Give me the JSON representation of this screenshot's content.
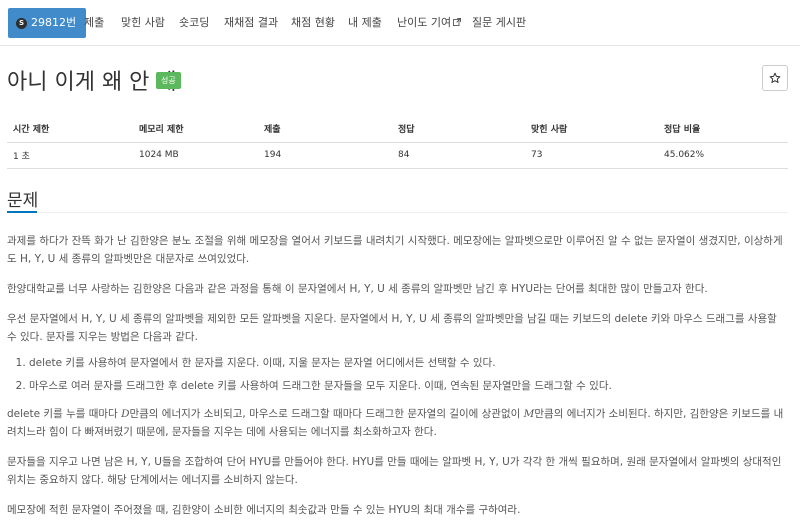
{
  "nav": {
    "problem_number": "29812번",
    "items": [
      "제출",
      "맞힌 사람",
      "숏코딩",
      "재채점 결과",
      "채점 현황",
      "내 제출",
      "난이도 기여",
      "질문 게시판"
    ]
  },
  "problem": {
    "title": "아니 이게 왜 안 돼",
    "status": "성공"
  },
  "info_table": {
    "headers": [
      "시간 제한",
      "메모리 제한",
      "제출",
      "정답",
      "맞힌 사람",
      "정답 비율"
    ],
    "values": [
      "1 초",
      "1024 MB",
      "194",
      "84",
      "73",
      "45.062%"
    ]
  },
  "section": {
    "title": "문제"
  },
  "description": {
    "p1": "과제를 하다가 잔뜩 화가 난 김한양은 분노 조절을 위해 메모장을 열어서 키보드를 내려치기 시작했다. 메모장에는 알파벳으로만 이루어진 알 수 없는 문자열이 생겼지만, 이상하게도 H, Y, U 세 종류의 알파벳만은 대문자로 쓰여있었다.",
    "p2": "한양대학교를 너무 사랑하는 김한양은 다음과 같은 과정을 통해 이 문자열에서 H, Y, U 세 종류의 알파벳만 남긴 후 HYU라는 단어를 최대한 많이 만들고자 한다.",
    "p3": "우선 문자열에서 H, Y, U 세 종류의 알파벳을 제외한 모든 알파벳을 지운다. 문자열에서 H, Y, U 세 종류의 알파벳만을 남길 때는 키보드의 delete 키와 마우스 드래그를 사용할 수 있다. 문자를 지우는 방법은 다음과 같다.",
    "li1": "delete 키를 사용하여 문자열에서 한 문자를 지운다. 이때, 지울 문자는 문자열 어디에서든 선택할 수 있다.",
    "li2": "마우스로 여러 문자를 드래그한 후 delete 키를 사용하여 드래그한 문자들을 모두 지운다. 이때, 연속된 문자열만을 드래그할 수 있다.",
    "p4_a": "delete 키를 누를 때마다 ",
    "p4_var_d": "D",
    "p4_b": "만큼의 에너지가 소비되고, 마우스로 드래그할 때마다 드래그한 문자열의 길이에 상관없이 ",
    "p4_var_m": "M",
    "p4_c": "만큼의 에너지가 소비된다. 하지만, 김한양은 키보드를 내려치느라 힘이 다 빠져버렸기 때문에, 문자들을 지우는 데에 사용되는 에너지를 최소화하고자 한다.",
    "p5": "문자들을 지우고 나면 남은 H, Y, U들을 조합하여 단어 HYU를 만들어야 한다. HYU를 만들 때에는 알파벳 H, Y, U가 각각 한 개씩 필요하며, 원래 문자열에서 알파벳의 상대적인 위치는 중요하지 않다. 해당 단계에서는 에너지를 소비하지 않는다.",
    "p6": "메모장에 적힌 문자열이 주어졌을 때, 김한양이 소비한 에너지의 최솟값과 만들 수 있는 HYU의 최대 개수를 구하여라."
  },
  "colors": {
    "nav_active": "#428bca",
    "status_success": "#5cb85c",
    "section_accent": "#0076c0"
  }
}
